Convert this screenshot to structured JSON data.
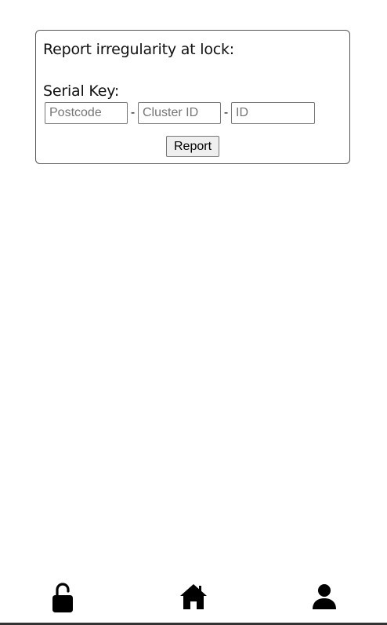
{
  "report_form": {
    "title": "Report irregularity at lock:",
    "serial_key_label": "Serial Key:",
    "postcode": {
      "value": "",
      "placeholder": "Postcode"
    },
    "cluster_id": {
      "value": "",
      "placeholder": "Cluster ID"
    },
    "id": {
      "value": "",
      "placeholder": "ID"
    },
    "separator": "-",
    "submit_label": "Report"
  },
  "bottom_nav": {
    "items": [
      {
        "icon": "lock-icon"
      },
      {
        "icon": "home-icon"
      },
      {
        "icon": "user-icon"
      }
    ]
  }
}
